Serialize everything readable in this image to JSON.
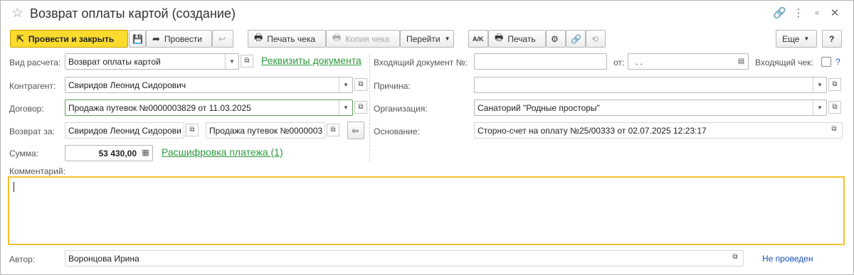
{
  "window": {
    "title": "Возврат оплаты картой (создание)"
  },
  "toolbar": {
    "post_close": "Провести и закрыть",
    "post": "Провести",
    "print_check": "Печать чека",
    "copy_check": "Копия чека",
    "goto": "Перейти",
    "print": "Печать",
    "more": "Еще",
    "help": "?"
  },
  "form": {
    "payment_type": {
      "label": "Вид расчета:",
      "value": "Возврат оплаты картой"
    },
    "doc_details_link": "Реквизиты документа",
    "counterparty": {
      "label": "Контрагент:",
      "value": "Свиридов Леонид Сидорович"
    },
    "contract": {
      "label": "Договор:",
      "value": "Продажа путевок №0000003829 от 11.03.2025"
    },
    "refund_for": {
      "label": "Возврат за:",
      "value_person": "Свиридов Леонид Сидорови",
      "value_contract": "Продажа путевок №0000003"
    },
    "amount": {
      "label": "Сумма:",
      "value": "53 430,00"
    },
    "payment_breakdown_link": "Расшифровка платежа (1)",
    "incoming_doc": {
      "label": "Входящий документ №:",
      "value": "",
      "date_label": "от:",
      "date_value": " .  .  "
    },
    "incoming_check": {
      "label": "Входящий чек:",
      "help": "?"
    },
    "reason": {
      "label": "Причина:",
      "value": ""
    },
    "organization": {
      "label": "Организация:",
      "value": "Санаторий \"Родные просторы\""
    },
    "basis": {
      "label": "Основание:",
      "value": "Сторно-счет на оплату №25/00333 от 02.07.2025 12:23:17"
    },
    "comment": {
      "label": "Комментарий:",
      "value": ""
    },
    "author": {
      "label": "Автор:",
      "value": "Воронцова Ирина"
    },
    "status": "Не проведен"
  },
  "colors": {
    "primary_button": "#fadb2e",
    "link": "#2b9a3c",
    "focus_border": "#f0c330",
    "status": "#1a4fb8"
  }
}
